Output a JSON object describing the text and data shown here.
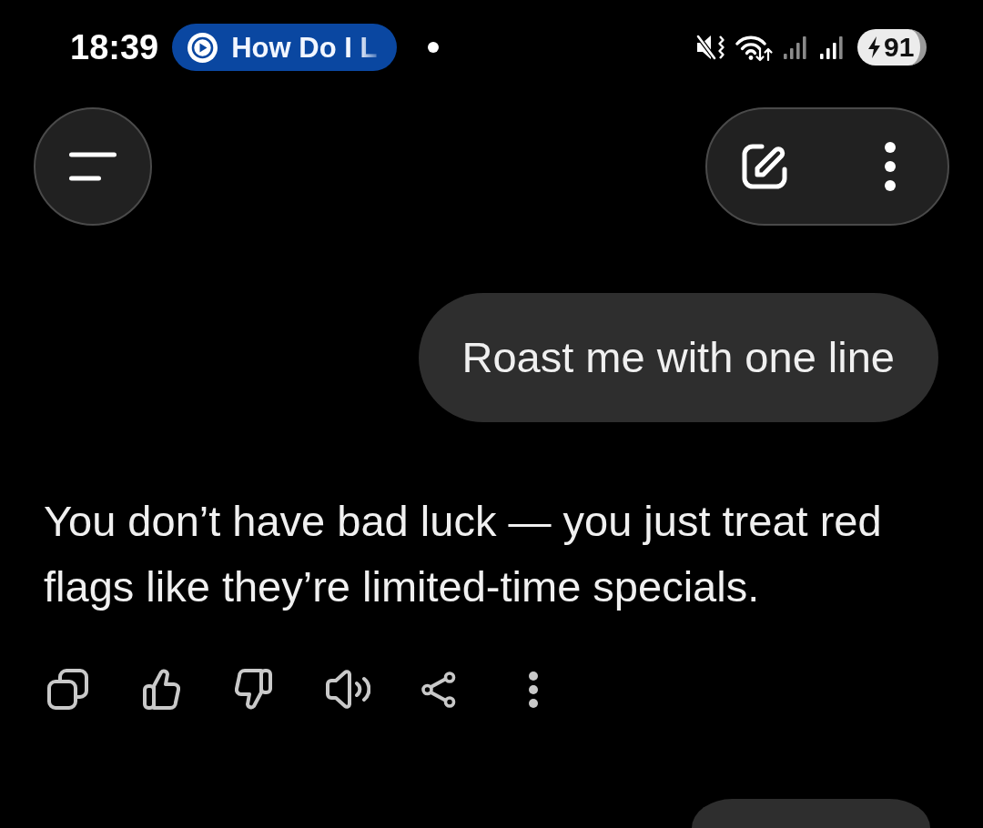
{
  "status_bar": {
    "time": "18:39",
    "media_chip": {
      "label": "How Do I L"
    },
    "battery": {
      "percent": "91",
      "charging": true
    }
  },
  "messages": [
    {
      "kind": "user",
      "text": "Roast me with one line"
    },
    {
      "kind": "assistant",
      "text": "You don’t have bad luck — you just treat red flags like they’re limited-time specials."
    },
    {
      "kind": "user"
    }
  ]
}
